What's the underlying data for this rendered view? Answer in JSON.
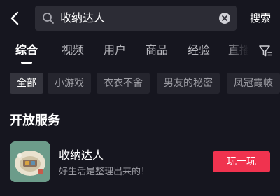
{
  "search": {
    "query": "收纳达人",
    "button_label": "搜索"
  },
  "tabs": [
    {
      "label": "综合",
      "active": true
    },
    {
      "label": "视频"
    },
    {
      "label": "用户"
    },
    {
      "label": "商品"
    },
    {
      "label": "经验"
    },
    {
      "label": "直播"
    }
  ],
  "chips": [
    {
      "label": "全部",
      "active": true
    },
    {
      "label": "小游戏"
    },
    {
      "label": "衣衣不舍"
    },
    {
      "label": "男友的秘密"
    },
    {
      "label": "凤冠霞帔"
    }
  ],
  "section": {
    "title": "开放服务"
  },
  "service": {
    "name": "收纳达人",
    "description": "好生活是整理出来的！",
    "action_label": "玩一玩"
  },
  "icons": {
    "back": "chevron-left-icon",
    "search": "search-icon",
    "clear": "clear-icon",
    "filter": "filter-icon",
    "app": "storage-game-icon"
  },
  "colors": {
    "background": "#16161f",
    "search_box": "#2c2c35",
    "chip": "#25252e",
    "accent": "#f0334f"
  }
}
